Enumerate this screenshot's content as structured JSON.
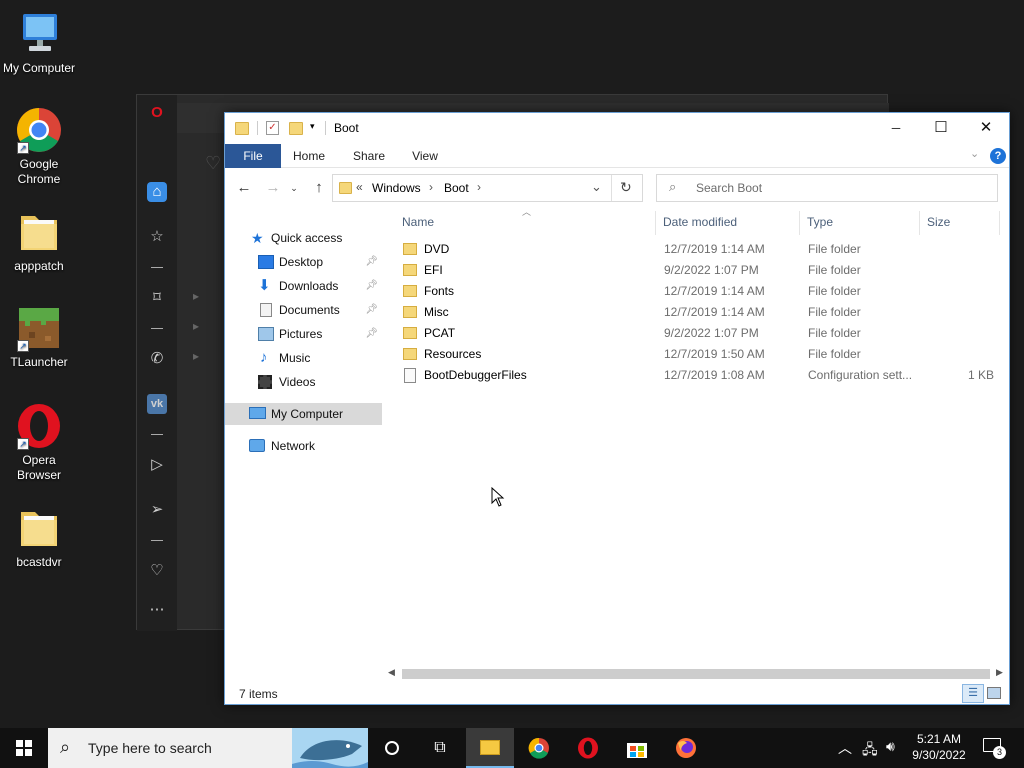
{
  "desktop": {
    "icons": [
      {
        "label": "My Computer",
        "name": "my-computer"
      },
      {
        "label": "Google Chrome",
        "name": "google-chrome"
      },
      {
        "label": "apppatch",
        "name": "apppatch"
      },
      {
        "label": "TLauncher",
        "name": "tlauncher"
      },
      {
        "label": "Opera Browser",
        "name": "opera-browser"
      },
      {
        "label": "bcastdvr",
        "name": "bcastdvr"
      }
    ]
  },
  "explorer": {
    "title": "Boot",
    "window_controls": {
      "minimize": "─",
      "maximize": "☐",
      "close": "✕"
    },
    "ribbon_tabs": [
      "File",
      "Home",
      "Share",
      "View"
    ],
    "address": {
      "overflow": "«",
      "crumbs": [
        "Windows",
        "Boot"
      ]
    },
    "search_placeholder": "Search Boot",
    "nav_pane": {
      "quick_access": "Quick access",
      "items": [
        "Desktop",
        "Downloads",
        "Documents",
        "Pictures",
        "Music",
        "Videos"
      ],
      "this_pc": "My Computer",
      "network": "Network"
    },
    "columns": {
      "name": "Name",
      "date": "Date modified",
      "type": "Type",
      "size": "Size"
    },
    "files": [
      {
        "name": "DVD",
        "date": "12/7/2019 1:14 AM",
        "type": "File folder",
        "size": "",
        "kind": "folder"
      },
      {
        "name": "EFI",
        "date": "9/2/2022 1:07 PM",
        "type": "File folder",
        "size": "",
        "kind": "folder"
      },
      {
        "name": "Fonts",
        "date": "12/7/2019 1:14 AM",
        "type": "File folder",
        "size": "",
        "kind": "folder"
      },
      {
        "name": "Misc",
        "date": "12/7/2019 1:14 AM",
        "type": "File folder",
        "size": "",
        "kind": "folder"
      },
      {
        "name": "PCAT",
        "date": "9/2/2022 1:07 PM",
        "type": "File folder",
        "size": "",
        "kind": "folder"
      },
      {
        "name": "Resources",
        "date": "12/7/2019 1:50 AM",
        "type": "File folder",
        "size": "",
        "kind": "folder"
      },
      {
        "name": "BootDebuggerFiles",
        "date": "12/7/2019 1:08 AM",
        "type": "Configuration sett...",
        "size": "1 KB",
        "kind": "config"
      }
    ],
    "status": "7 items"
  },
  "taskbar": {
    "search_placeholder": "Type here to search",
    "time": "5:21 AM",
    "date": "9/30/2022",
    "notification_count": "3"
  },
  "colors": {
    "file_tab": "#2b5797",
    "folder": "#f5d77a",
    "selected_nav": "#d9d9d9",
    "taskbar": "#111111"
  }
}
